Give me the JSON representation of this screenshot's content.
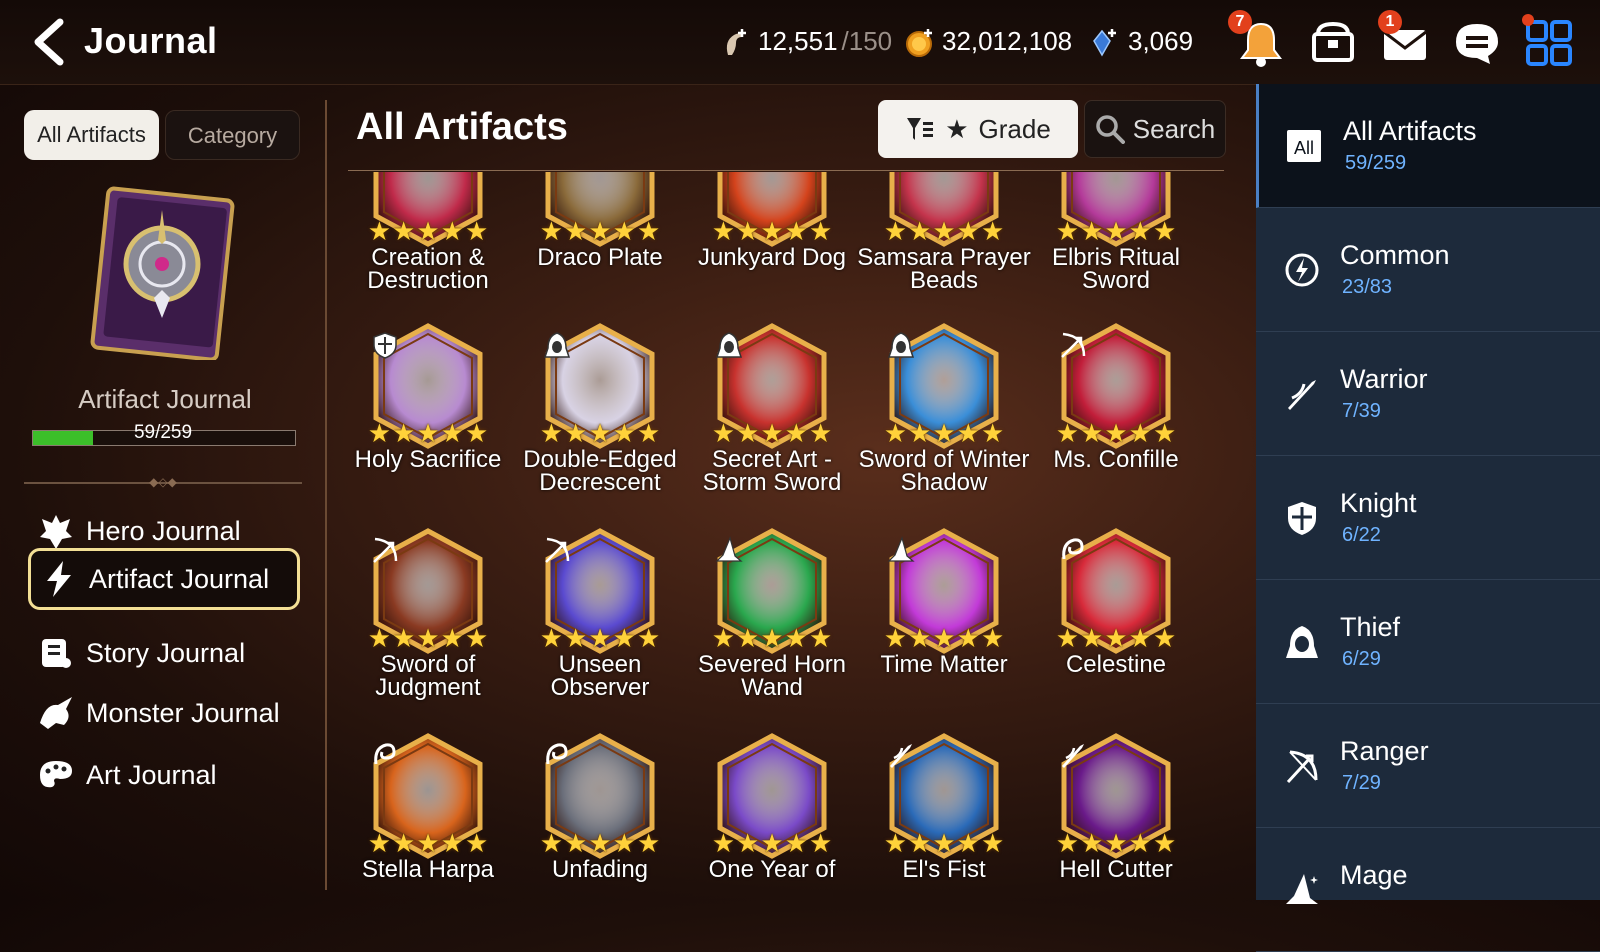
{
  "header": {
    "title": "Journal",
    "stamina": {
      "value": "12,551",
      "max": "/150"
    },
    "gold": "32,012,108",
    "crystals": "3,069",
    "notifications_badge": "7",
    "mail_badge": "1"
  },
  "left": {
    "tabs": [
      "All Artifacts",
      "Category"
    ],
    "book_name": "Artifact Journal",
    "progress_text": "59/259",
    "progress_fraction": 0.228,
    "nav": [
      {
        "label": "Hero Journal",
        "icon": "hero-icon"
      },
      {
        "label": "Artifact Journal",
        "icon": "lightning-icon"
      },
      {
        "label": "Story Journal",
        "icon": "scroll-icon"
      },
      {
        "label": "Monster Journal",
        "icon": "monster-icon"
      },
      {
        "label": "Art Journal",
        "icon": "palette-icon"
      }
    ]
  },
  "main": {
    "title": "All Artifacts",
    "grade_label": "Grade",
    "search_label": "Search",
    "rows": [
      [
        {
          "name_lines": [
            "Creation &",
            "Destruction"
          ],
          "stars": 5,
          "class": "",
          "color": "#c02a4a"
        },
        {
          "name_lines": [
            "Draco Plate",
            ""
          ],
          "stars": 5,
          "class": "",
          "color": "#8a6a3a"
        },
        {
          "name_lines": [
            "Junkyard Dog",
            ""
          ],
          "stars": 5,
          "class": "",
          "color": "#d4431c"
        },
        {
          "name_lines": [
            "Samsara Prayer",
            "Beads"
          ],
          "stars": 5,
          "class": "",
          "color": "#c4344c"
        },
        {
          "name_lines": [
            "Elbris Ritual",
            "Sword"
          ],
          "stars": 5,
          "class": "",
          "color": "#b43a9a"
        }
      ],
      [
        {
          "name_lines": [
            "Holy Sacrifice",
            ""
          ],
          "stars": 5,
          "class": "knight",
          "color": "#b78ad0"
        },
        {
          "name_lines": [
            "Double-Edged",
            "Decrescent"
          ],
          "stars": 5,
          "class": "thief",
          "color": "#d8d2e4"
        },
        {
          "name_lines": [
            "Secret Art -",
            "Storm Sword"
          ],
          "stars": 5,
          "class": "thief",
          "color": "#c8322e"
        },
        {
          "name_lines": [
            "Sword of Winter",
            "Shadow"
          ],
          "stars": 5,
          "class": "thief",
          "color": "#3a8ed8"
        },
        {
          "name_lines": [
            "Ms. Confille",
            ""
          ],
          "stars": 5,
          "class": "ranger",
          "color": "#c21e3a"
        }
      ],
      [
        {
          "name_lines": [
            "Sword of",
            "Judgment"
          ],
          "stars": 5,
          "class": "ranger",
          "color": "#8a3a22"
        },
        {
          "name_lines": [
            "Unseen",
            "Observer"
          ],
          "stars": 5,
          "class": "ranger",
          "color": "#5a4ad0"
        },
        {
          "name_lines": [
            "Severed Horn",
            "Wand"
          ],
          "stars": 5,
          "class": "mage",
          "color": "#2aa84e"
        },
        {
          "name_lines": [
            "Time Matter",
            ""
          ],
          "stars": 5,
          "class": "mage",
          "color": "#c23ad8"
        },
        {
          "name_lines": [
            "Celestine",
            ""
          ],
          "stars": 5,
          "class": "soul-weaver",
          "color": "#d82a3a"
        }
      ],
      [
        {
          "name_lines": [
            "Stella Harpa",
            ""
          ],
          "stars": 5,
          "class": "soul-weaver",
          "color": "#d8641c"
        },
        {
          "name_lines": [
            "Unfading",
            ""
          ],
          "stars": 5,
          "class": "soul-weaver",
          "color": "#6a6e7a"
        },
        {
          "name_lines": [
            "One Year of",
            ""
          ],
          "stars": 5,
          "class": "",
          "color": "#7a4ac8"
        },
        {
          "name_lines": [
            "El's Fist",
            ""
          ],
          "stars": 5,
          "class": "warrior",
          "color": "#2a6ab8"
        },
        {
          "name_lines": [
            "Hell Cutter",
            ""
          ],
          "stars": 5,
          "class": "warrior",
          "color": "#6a1a8a"
        }
      ]
    ]
  },
  "right": {
    "items": [
      {
        "label": "All Artifacts",
        "count": "59/259",
        "icon": "all-icon",
        "icon_text": "All"
      },
      {
        "label": "Common",
        "count": "23/83",
        "icon": "common-icon"
      },
      {
        "label": "Warrior",
        "count": "7/39",
        "icon": "warrior-icon"
      },
      {
        "label": "Knight",
        "count": "6/22",
        "icon": "knight-shield-icon"
      },
      {
        "label": "Thief",
        "count": "6/29",
        "icon": "thief-hood-icon"
      },
      {
        "label": "Ranger",
        "count": "7/29",
        "icon": "ranger-bow-icon"
      },
      {
        "label": "Mage",
        "count": "",
        "icon": "mage-hat-icon"
      }
    ]
  }
}
